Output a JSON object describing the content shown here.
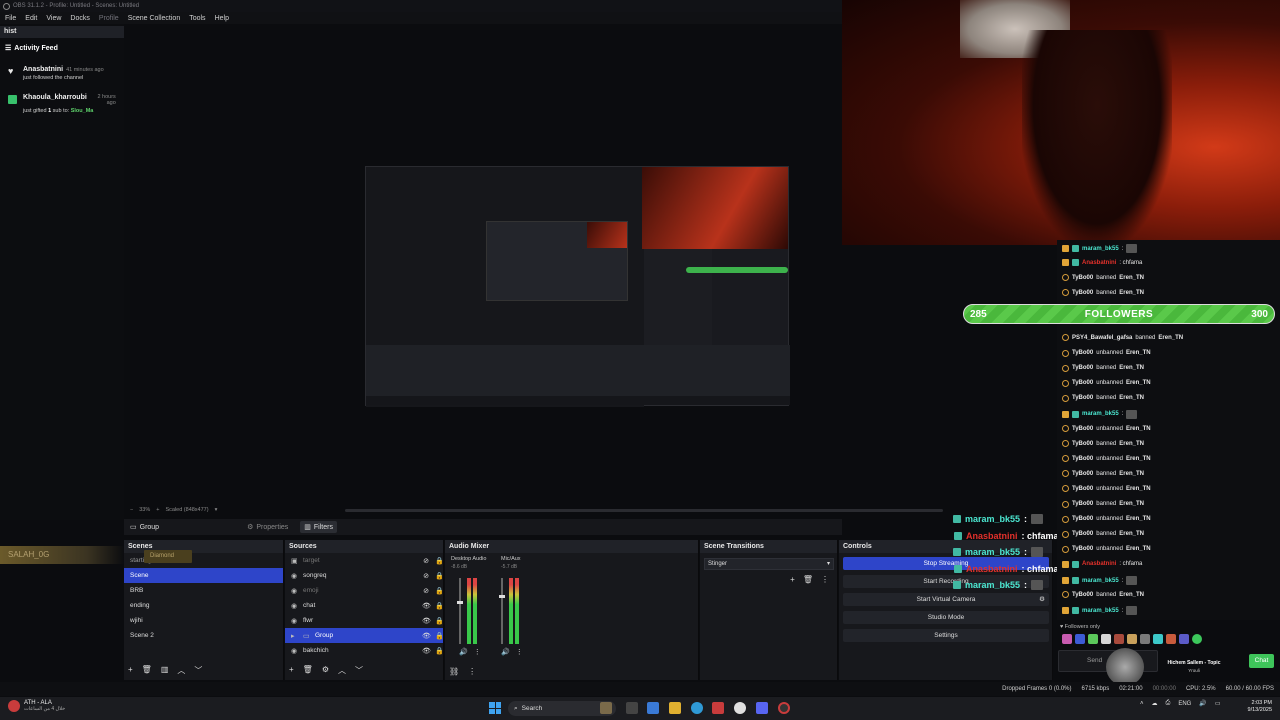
{
  "window": {
    "title": "OBS 31.1.2 - Profile: Untitled - Scenes: Untitled"
  },
  "menu": [
    "File",
    "Edit",
    "View",
    "Docks",
    "Profile",
    "Scene Collection",
    "Tools",
    "Help"
  ],
  "left_dock": {
    "title": "hist",
    "activity_header": "Activity Feed",
    "items": [
      {
        "name": "Anasbatnini",
        "time": "41 minutes ago",
        "text": "just followed the channel"
      },
      {
        "name": "Khaoula_kharroubi",
        "time": "2 hours ago",
        "text": "just gifted",
        "count": "1",
        "text2": "sub to:",
        "target": "Slou_Ma"
      }
    ]
  },
  "zoom": {
    "level": "33%",
    "mode": "Scaled (848x477)"
  },
  "scene_header": {
    "name": "Group",
    "properties": "Properties",
    "filters": "Filters"
  },
  "overlay": {
    "salah": "SALAH_0G",
    "diamond": "Diamond"
  },
  "scenes": {
    "title": "Scenes",
    "items": [
      "starting",
      "Scene",
      "BRB",
      "ending",
      "wjihi",
      "Scene 2"
    ],
    "selected": "Scene"
  },
  "sources": {
    "title": "Sources",
    "items": [
      {
        "name": "target",
        "dim": true
      },
      {
        "name": "songreq",
        "dim": false
      },
      {
        "name": "emoji",
        "dim": true
      },
      {
        "name": "chat",
        "dim": false
      },
      {
        "name": "flwr",
        "dim": false
      },
      {
        "name": "Group",
        "dim": false
      },
      {
        "name": "bakchich",
        "dim": false
      }
    ],
    "selected": "Group"
  },
  "mixer": {
    "title": "Audio Mixer",
    "channels": [
      {
        "name": "Desktop Audio",
        "db": "-8.6 dB",
        "fader": 0.35
      },
      {
        "name": "Mic/Aux",
        "db": "-5.7 dB",
        "fader": 0.25
      }
    ]
  },
  "transitions": {
    "title": "Scene Transitions",
    "selected": "Stinger"
  },
  "controls": {
    "title": "Controls",
    "buttons": [
      "Stop Streaming",
      "Start Recording",
      "Start Virtual Camera",
      "Studio Mode",
      "Settings"
    ]
  },
  "overlay_chat": [
    {
      "user": "maram_bk55",
      "msg": ":",
      "color": "#4be6d0"
    },
    {
      "user": "Anasbatnini",
      "msg": ": chfama",
      "color": "#e3312b"
    },
    {
      "user": "maram_bk55",
      "msg": ":",
      "color": "#4be6d0"
    },
    {
      "user": "Anasbatnini",
      "msg": ": chfama",
      "color": "#e3312b"
    },
    {
      "user": "maram_bk55",
      "msg": ":",
      "color": "#4be6d0"
    }
  ],
  "followers_bar": {
    "current": "285",
    "label": "FOLLOWERS",
    "goal": "300",
    "progress": 0.95
  },
  "chat": {
    "lines": [
      {
        "badge": "gem",
        "user": "maram_bk55",
        "color": "teal",
        "text": ":",
        "avatar": true
      },
      {
        "badge": "gem",
        "user": "Anasbatnini",
        "color": "red",
        "text": ": chfama",
        "avatar": false
      },
      {
        "badge": "circle",
        "user": "TyBo00",
        "color": "white",
        "text": "banned",
        "target": "Eren_TN"
      },
      {
        "badge": "circle",
        "user": "TyBo00",
        "color": "white",
        "text": "banned",
        "target": "Eren_TN"
      },
      {
        "badge": "circle",
        "user": "PSY4_Bawafel_gafsa",
        "color": "white",
        "text": "banned",
        "target": "Eren_TN"
      },
      {
        "badge": "circle",
        "user": "TyBo00",
        "color": "white",
        "text": "unbanned",
        "target": "Eren_TN"
      },
      {
        "badge": "circle",
        "user": "TyBo00",
        "color": "white",
        "text": "banned",
        "target": "Eren_TN"
      },
      {
        "badge": "circle",
        "user": "TyBo00",
        "color": "white",
        "text": "unbanned",
        "target": "Eren_TN"
      },
      {
        "badge": "circle",
        "user": "TyBo00",
        "color": "white",
        "text": "banned",
        "target": "Eren_TN"
      },
      {
        "badge": "gem",
        "user": "maram_bk55",
        "color": "teal",
        "text": ":",
        "avatar": true
      },
      {
        "badge": "circle",
        "user": "TyBo00",
        "color": "white",
        "text": "unbanned",
        "target": "Eren_TN"
      },
      {
        "badge": "circle",
        "user": "TyBo00",
        "color": "white",
        "text": "banned",
        "target": "Eren_TN"
      },
      {
        "badge": "circle",
        "user": "TyBo00",
        "color": "white",
        "text": "unbanned",
        "target": "Eren_TN"
      },
      {
        "badge": "circle",
        "user": "TyBo00",
        "color": "white",
        "text": "banned",
        "target": "Eren_TN"
      },
      {
        "badge": "circle",
        "user": "TyBo00",
        "color": "white",
        "text": "unbanned",
        "target": "Eren_TN"
      },
      {
        "badge": "circle",
        "user": "TyBo00",
        "color": "white",
        "text": "banned",
        "target": "Eren_TN"
      },
      {
        "badge": "circle",
        "user": "TyBo00",
        "color": "white",
        "text": "unbanned",
        "target": "Eren_TN"
      },
      {
        "badge": "circle",
        "user": "TyBo00",
        "color": "white",
        "text": "banned",
        "target": "Eren_TN"
      },
      {
        "badge": "circle",
        "user": "TyBo00",
        "color": "white",
        "text": "unbanned",
        "target": "Eren_TN"
      },
      {
        "badge": "gem",
        "user": "Anasbatnini",
        "color": "red",
        "text": ": chfama",
        "avatar": false
      },
      {
        "badge": "gem",
        "user": "maram_bk55",
        "color": "teal",
        "text": ":",
        "avatar": true
      },
      {
        "badge": "circle",
        "user": "TyBo00",
        "color": "white",
        "text": "banned",
        "target": "Eren_TN"
      },
      {
        "badge": "gem",
        "user": "maram_bk55",
        "color": "teal",
        "text": ":",
        "avatar": true
      }
    ],
    "followers_only": "Followers only",
    "send_placeholder": "Send",
    "chat_button": "Chat",
    "now_playing_title": "Hichem Sallem - Topic",
    "now_playing_sub": "Yrouli"
  },
  "status": {
    "dropped": "Dropped Frames 0 (0.0%)",
    "bitrate": "6715 kbps",
    "live_time": "02:21:00",
    "rec_time": "00:00:00",
    "cpu": "CPU: 2.5%",
    "fps": "60.00 / 60.00 FPS"
  },
  "taskbar": {
    "media_title": "ATH - ALA",
    "media_sub": "خلال 4 من الساعات",
    "search": "Search",
    "lang": "ENG",
    "time": "2:03 PM",
    "date": "9/13/2025"
  },
  "colors": {
    "accent": "#2e45c9",
    "green": "#3ec45a",
    "red_user": "#e3312b",
    "teal_user": "#4be6d0"
  }
}
